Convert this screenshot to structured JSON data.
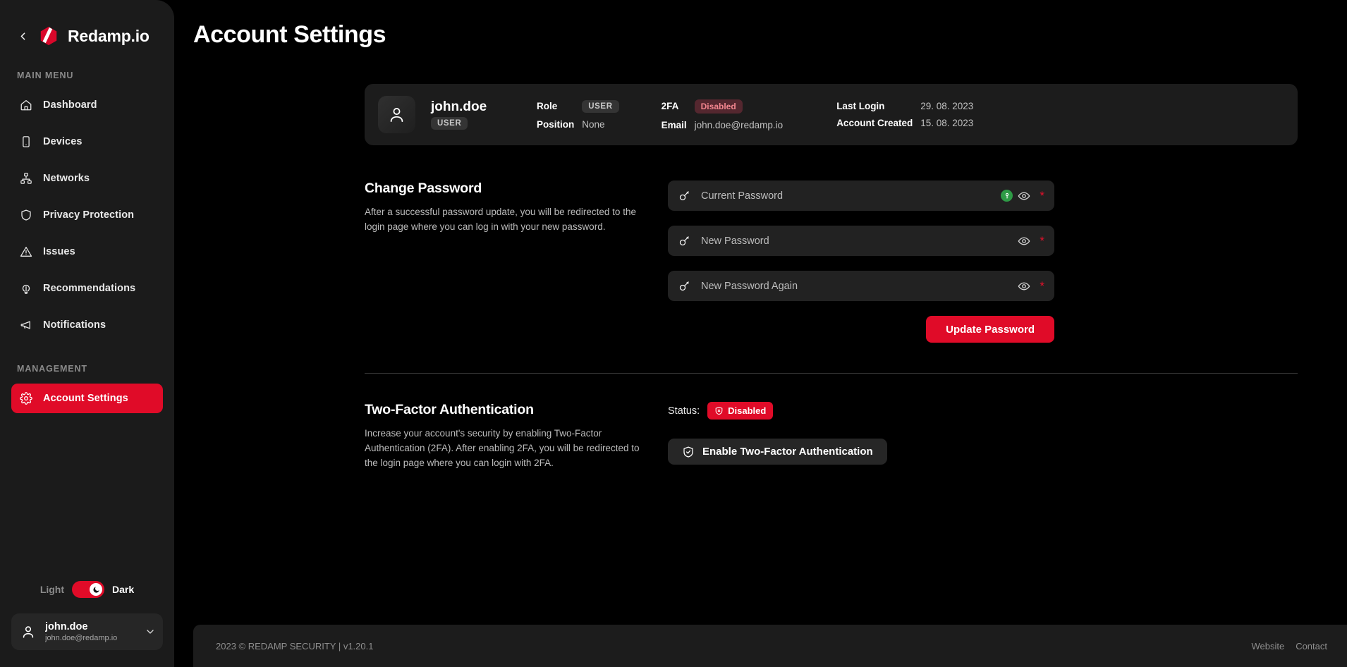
{
  "sidebar": {
    "brand": {
      "name": "Redamp.io",
      "back_icon": "chevron-left-icon",
      "logo_icon": "redamp-logo-icon"
    },
    "main_menu_label": "MAIN MENU",
    "main_items": [
      {
        "label": "Dashboard",
        "icon": "home-icon"
      },
      {
        "label": "Devices",
        "icon": "device-mobile-icon"
      },
      {
        "label": "Networks",
        "icon": "network-icon"
      },
      {
        "label": "Privacy Protection",
        "icon": "shield-icon"
      },
      {
        "label": "Issues",
        "icon": "warning-triangle-icon"
      },
      {
        "label": "Recommendations",
        "icon": "lightbulb-icon"
      },
      {
        "label": "Notifications",
        "icon": "megaphone-icon"
      }
    ],
    "management_label": "MANAGEMENT",
    "management_items": [
      {
        "label": "Account Settings",
        "icon": "gear-icon",
        "active": true
      }
    ],
    "theme": {
      "light_label": "Light",
      "dark_label": "Dark",
      "selected": "Dark",
      "knob_icon": "moon-icon"
    },
    "user_chip": {
      "name": "john.doe",
      "email": "john.doe@redamp.io",
      "avatar_icon": "user-icon",
      "caret_icon": "chevron-down-icon"
    }
  },
  "header": {
    "title": "Account Settings"
  },
  "profile_card": {
    "avatar_icon": "user-icon",
    "username": "john.doe",
    "user_badge": "USER",
    "fields": [
      {
        "key": "Role",
        "value": "USER",
        "style": "chip-gray"
      },
      {
        "key": "Position",
        "value": "None",
        "style": "plain"
      },
      {
        "key": "2FA",
        "value": "Disabled",
        "style": "chip-danger"
      },
      {
        "key": "Email",
        "value": "john.doe@redamp.io",
        "style": "plain"
      },
      {
        "key": "Last Login",
        "value": "29. 08. 2023",
        "style": "plain"
      },
      {
        "key": "Account Created",
        "value": "15. 08. 2023",
        "style": "plain"
      }
    ]
  },
  "change_password": {
    "title": "Change Password",
    "description": "After a successful password update, you will be redirected to the login page where you can log in with your new password.",
    "fields": [
      {
        "placeholder": "Current Password",
        "value": "",
        "key_icon": "key-icon",
        "eye_icon": "eye-icon",
        "password_manager_icon": "password-manager-key-icon",
        "required_marker": "*"
      },
      {
        "placeholder": "New Password",
        "value": "",
        "key_icon": "key-icon",
        "eye_icon": "eye-icon",
        "required_marker": "*"
      },
      {
        "placeholder": "New Password Again",
        "value": "",
        "key_icon": "key-icon",
        "eye_icon": "eye-icon",
        "required_marker": "*"
      }
    ],
    "submit_label": "Update Password"
  },
  "two_factor": {
    "title": "Two-Factor Authentication",
    "description": "Increase your account's security by enabling Two-Factor Authentication (2FA). After enabling 2FA, you will be redirected to the login page where you can login with 2FA.",
    "status_label": "Status:",
    "status_value": "Disabled",
    "status_icon": "shield-x-icon",
    "enable_button_label": "Enable Two-Factor Authentication",
    "enable_button_icon": "shield-check-icon"
  },
  "footer": {
    "copyright": "2023 © REDAMP SECURITY | v1.20.1",
    "links": [
      {
        "label": "Website"
      },
      {
        "label": "Contact"
      }
    ]
  },
  "colors": {
    "accent_red": "#e00b28",
    "sidebar_bg": "#1b1b1b",
    "page_bg": "#000000",
    "card_bg": "#1c1c1c",
    "field_bg": "#222222",
    "danger_chip_bg": "#54272f",
    "danger_chip_text": "#f2868f",
    "pw_manager_green": "#2e9b46"
  }
}
